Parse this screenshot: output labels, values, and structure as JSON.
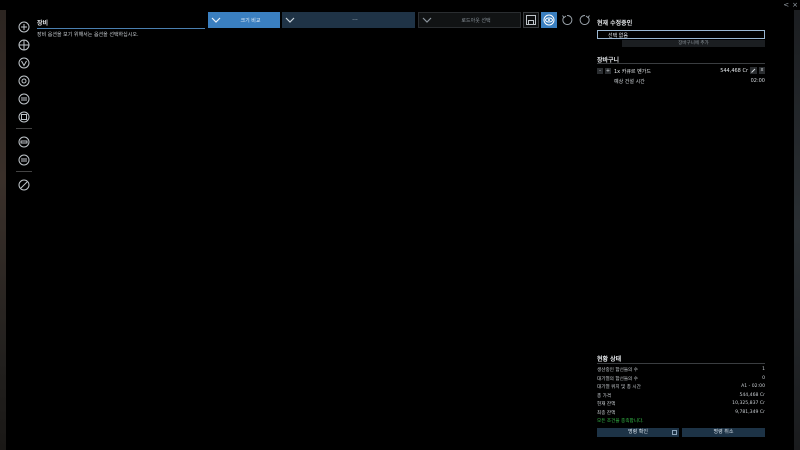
{
  "window": {
    "minimize": "<",
    "close": "×"
  },
  "toolbar": {
    "icons": [
      "crosshair-icon",
      "module-icon",
      "armor-icon",
      "engine-icon",
      "drone-icon",
      "cargo-icon",
      "shield-icon",
      "ammo-icon",
      "cancel-icon"
    ]
  },
  "equipment": {
    "title": "장비",
    "hint": "장비 옵션을 보기 위해서는 옵션을 선택하십시오."
  },
  "filters": {
    "size": "크기 비교",
    "type": "---",
    "loadout": "로드아웃 선택"
  },
  "right_panel": {
    "current_head": "현재 수정중인",
    "selection": "선택 없음",
    "add_to_cart": "장바구니에 추가",
    "cart_head": "장바구니",
    "cart_item": {
      "minus": "-",
      "plus": "+",
      "name": "1x 카큐르 벤가드",
      "price": "544,468 Cr",
      "delete": "x"
    },
    "build_time": {
      "label": "예상 건설 시간",
      "value": "02:00"
    },
    "status_head": "현황 상태",
    "status_rows": [
      {
        "k": "생산중인 함선들의 수",
        "v": "1"
      },
      {
        "k": "대기열의 함선들의 수",
        "v": "0"
      },
      {
        "k": "대기열 위치 및 총 시간",
        "v": "A1 - 02:00"
      },
      {
        "k": "총 가격",
        "v": "544,468 Cr"
      },
      {
        "k": "현재 잔액",
        "v": "10,325,837 Cr"
      },
      {
        "k": "최종 잔액",
        "v": "9,781,349 Cr"
      }
    ],
    "ok_message": "모든 조건을 충족합니다.",
    "confirm_button": "명령 확인",
    "cancel_button": "명령 취소"
  },
  "colors": {
    "accent": "#3a7fc0",
    "dark_button": "#1d3346",
    "ok_green": "#38c24a"
  }
}
